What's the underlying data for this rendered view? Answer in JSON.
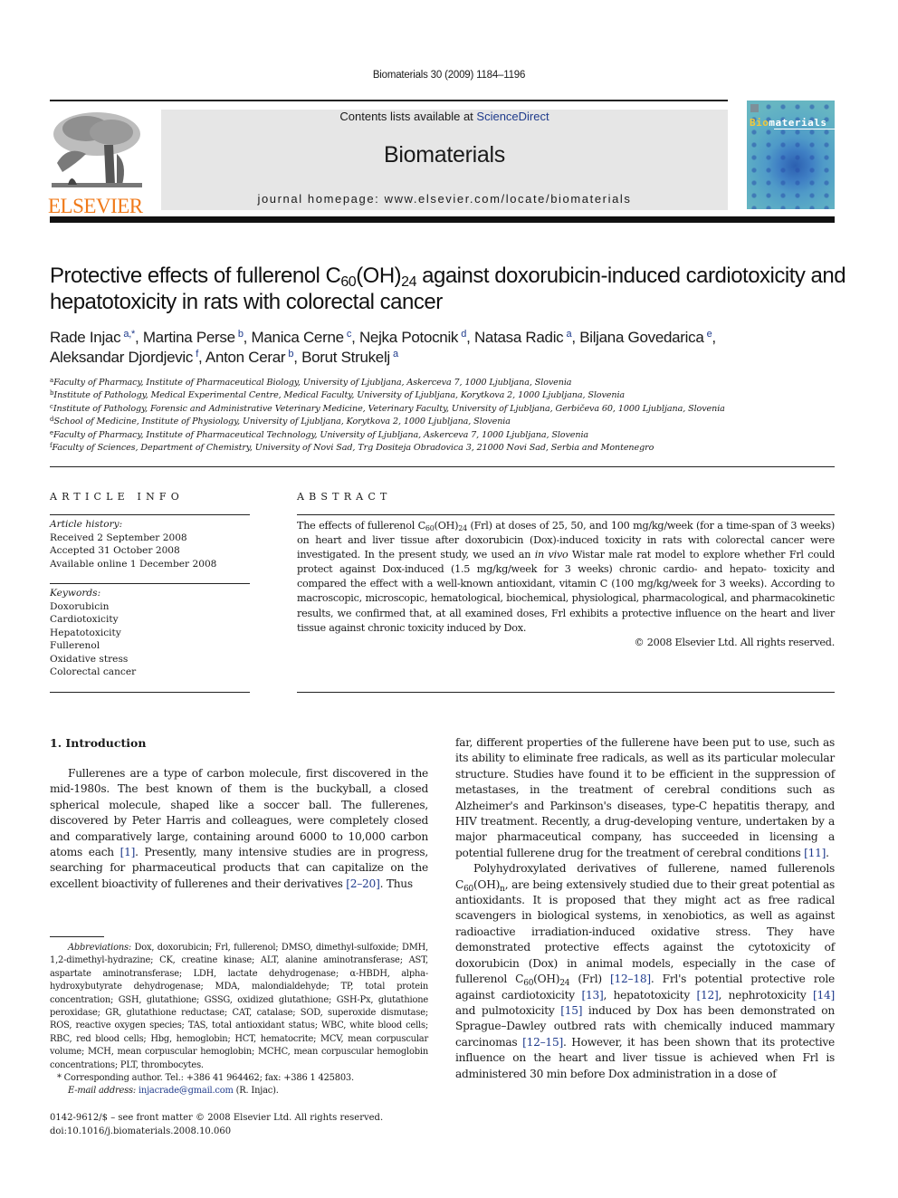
{
  "header": {
    "citation": "Biomaterials 30 (2009) 1184–1196",
    "contents_prefix": "Contents lists available at ",
    "contents_link": "ScienceDirect",
    "journal_title": "Biomaterials",
    "homepage": "journal homepage: www.elsevier.com/locate/biomaterials",
    "publisher_wordmark": "ELSEVIER",
    "cover_title_highlight": "Bio",
    "cover_title_rest": "materials",
    "colors": {
      "publisher_orange": "#f07a1a",
      "link_blue": "#1f3b8c",
      "banner_gray": "#e6e6e6"
    }
  },
  "article": {
    "title_part1": "Protective effects of fullerenol C",
    "title_sub1": "60",
    "title_part2": "(OH)",
    "title_sub2": "24",
    "title_part3": " against doxorubicin-induced cardiotoxicity and hepatotoxicity in rats with colorectal cancer",
    "authors": [
      {
        "name": "Rade Injac",
        "aff": "a,*",
        "sep": ", "
      },
      {
        "name": "Martina Perse",
        "aff": "b",
        "sep": ", "
      },
      {
        "name": "Manica Cerne",
        "aff": "c",
        "sep": ", "
      },
      {
        "name": "Nejka Potocnik",
        "aff": "d",
        "sep": ", "
      },
      {
        "name": "Natasa Radic",
        "aff": "a",
        "sep": ", "
      },
      {
        "name": "Biljana Govedarica",
        "aff": "e",
        "sep": ","
      },
      {
        "name": "Aleksandar Djordjevic",
        "aff": "f",
        "sep": ", "
      },
      {
        "name": "Anton Cerar",
        "aff": "b",
        "sep": ", "
      },
      {
        "name": "Borut Strukelj",
        "aff": "a",
        "sep": ""
      }
    ],
    "affiliations": [
      {
        "key": "a",
        "text": "Faculty of Pharmacy, Institute of Pharmaceutical Biology, University of Ljubljana, Askerceva 7, 1000 Ljubljana, Slovenia"
      },
      {
        "key": "b",
        "text": "Institute of Pathology, Medical Experimental Centre, Medical Faculty, University of Ljubljana, Korytkova 2, 1000 Ljubljana, Slovenia"
      },
      {
        "key": "c",
        "text": "Institute of Pathology, Forensic and Administrative Veterinary Medicine, Veterinary Faculty, University of Ljubljana, Gerbičeva 60, 1000 Ljubljana, Slovenia"
      },
      {
        "key": "d",
        "text": "School of Medicine, Institute of Physiology, University of Ljubljana, Korytkova 2, 1000 Ljubljana, Slovenia"
      },
      {
        "key": "e",
        "text": "Faculty of Pharmacy, Institute of Pharmaceutical Technology, University of Ljubljana, Askerceva 7, 1000 Ljubljana, Slovenia"
      },
      {
        "key": "f",
        "text": "Faculty of Sciences, Department of Chemistry, University of Novi Sad, Trg Dositeja Obradovica 3, 21000 Novi Sad, Serbia and Montenegro"
      }
    ]
  },
  "article_info": {
    "heading": "ARTICLE INFO",
    "history_label": "Article history:",
    "history": [
      "Received 2 September 2008",
      "Accepted 31 October 2008",
      "Available online 1 December 2008"
    ],
    "keywords_label": "Keywords:",
    "keywords": [
      "Doxorubicin",
      "Cardiotoxicity",
      "Hepatotoxicity",
      "Fullerenol",
      "Oxidative stress",
      "Colorectal cancer"
    ]
  },
  "abstract": {
    "heading": "ABSTRACT",
    "t1": "The effects of fullerenol C",
    "s1": "60",
    "t2": "(OH)",
    "s2": "24",
    "t3": " (Frl) at doses of 25, 50, and 100 mg/kg/week (for a time-span of 3 weeks) on heart and liver tissue after doxorubicin (Dox)-induced toxicity in rats with colorectal cancer were investigated. In the present study, we used an ",
    "italic": "in vivo",
    "t4": " Wistar male rat model to explore whether Frl could protect against Dox-induced (1.5 mg/kg/week for 3 weeks) chronic cardio- and hepato- toxicity and compared the effect with a well-known antioxidant, vitamin C (100 mg/kg/week for 3 weeks). According to macroscopic, microscopic, hematological, biochemical, physiological, pharmacological, and pharmacokinetic results, we confirmed that, at all examined doses, Frl exhibits a protective influence on the heart and liver tissue against chronic toxicity induced by Dox.",
    "copyright": "© 2008 Elsevier Ltd. All rights reserved."
  },
  "introduction": {
    "heading": "1.  Introduction",
    "p1_a": "Fullerenes are a type of carbon molecule, first discovered in the mid-1980s. The best known of them is the buckyball, a closed spherical molecule, shaped like a soccer ball. The fullerenes, discovered by Peter Harris and colleagues, were completely closed and comparatively large, containing around 6000 to 10,000 carbon atoms each ",
    "p1_ref1": "[1]",
    "p1_b": ". Presently, many intensive studies are in progress, searching for pharmaceutical products that can capitalize on the excellent bioactivity of fullerenes and their derivatives ",
    "p1_ref2": "[2–20]",
    "p1_c": ". Thus",
    "r1_a": "far, different properties of the fullerene have been put to use, such as its ability to eliminate free radicals, as well as its particular molecular structure. Studies have found it to be efficient in the suppression of metastases, in the treatment of cerebral conditions such as Alzheimer's and Parkinson's diseases, type-C hepatitis therapy, and HIV treatment. Recently, a drug-developing venture, undertaken by a major pharmaceutical company, has succeeded in licensing a potential fullerene drug for the treatment of cerebral conditions ",
    "r1_ref": "[11]",
    "r1_b": ".",
    "p2_a": "Polyhydroxylated derivatives of fullerene, named fullerenols C",
    "p2_s1": "60",
    "p2_b": "(OH)",
    "p2_s2": "n",
    "p2_c": ", are being extensively studied due to their great potential as antioxidants. It is proposed that they might act as free radical scavengers in biological systems, in xenobiotics, as well as against radioactive irradiation-induced oxidative stress. They have demonstrated protective effects against the cytotoxicity of doxorubicin (Dox) in animal models, especially in the case of fullerenol C",
    "p2_s3": "60",
    "p2_d": "(OH)",
    "p2_s4": "24",
    "p2_e": " (Frl) ",
    "p2_ref1": "[12–18]",
    "p2_f": ". Frl's potential protective role against cardiotoxicity ",
    "p2_ref2": "[13]",
    "p2_g": ", hepatotoxicity ",
    "p2_ref3": "[12]",
    "p2_h": ", nephrotoxicity ",
    "p2_ref4": "[14]",
    "p2_i": " and pulmotoxicity ",
    "p2_ref5": "[15]",
    "p2_j": " induced by Dox has been demonstrated on Sprague–Dawley outbred rats with chemically induced mammary carcinomas ",
    "p2_ref6": "[12–15]",
    "p2_k": ". However, it has been shown that its protective influence on the heart and liver tissue is achieved when Frl is administered 30 min before Dox administration in a dose of"
  },
  "footnotes": {
    "abbrev_label": "Abbreviations:",
    "abbrev_text": " Dox, doxorubicin; Frl, fullerenol; DMSO, dimethyl-sulfoxide; DMH, 1,2-dimethyl-hydrazine; CK, creatine kinase; ALT, alanine aminotransferase; AST, aspartate aminotransferase; LDH, lactate dehydrogenase; α-HBDH, alpha-hydroxybutyrate dehydrogenase; MDA, malondialdehyde; TP, total protein concentration; GSH, glutathione; GSSG, oxidized glutathione; GSH-Px, glutathione peroxidase; GR, glutathione reductase; CAT, catalase; SOD, superoxide dismutase; ROS, reactive oxygen species; TAS, total antioxidant status; WBC, white blood cells; RBC, red blood cells; Hbg, hemoglobin; HCT, hematocrite; MCV, mean corpuscular volume; MCH, mean corpuscular hemoglobin; MCHC, mean corpuscular hemoglobin concentrations; PLT, thrombocytes.",
    "corresponding": "* Corresponding author. Tel.: +386 41 964462; fax: +386 1 425803.",
    "email_label": "E-mail address:",
    "email": "injacrade@gmail.com",
    "email_suffix": " (R. Injac).",
    "front_matter": "0142-9612/$ – see front matter © 2008 Elsevier Ltd. All rights reserved.",
    "doi": "doi:10.1016/j.biomaterials.2008.10.060"
  }
}
